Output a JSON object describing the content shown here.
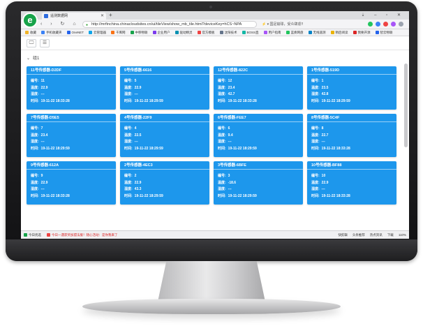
{
  "browser": {
    "tab_title": "遥测数据网",
    "new_tab": "+",
    "window_controls": "⇣ – ▫ ✕",
    "nav_buttons": "‹ › ↻ ⌂",
    "url": "http://mrfinchina.chinacloudsites.cn/ui/tileView/show_mb_tile.html?deviceKey=hCS~NPA",
    "address_extra": "⚡ ▾  国足输球，受众肆虐!!"
  },
  "bookmarks": [
    {
      "label": "收藏",
      "color": "#f0b429"
    },
    {
      "label": "手机收藏夹",
      "color": "#3b82f6"
    },
    {
      "label": "OneNET",
      "color": "#2563eb"
    },
    {
      "label": "云管理器",
      "color": "#0ea5e9"
    },
    {
      "label": "千库网",
      "color": "#f97316"
    },
    {
      "label": "中移物联",
      "color": "#16a34a"
    },
    {
      "label": "企业用户",
      "color": "#7c3aed"
    },
    {
      "label": "驱动精灵",
      "color": "#0891b2"
    },
    {
      "label": "官方模板",
      "color": "#ef4444"
    },
    {
      "label": "沈阳技术",
      "color": "#64748b"
    },
    {
      "label": "BOSS直",
      "color": "#14b8a6"
    },
    {
      "label": "用户指南",
      "color": "#a855f7"
    },
    {
      "label": "蓝奏网盘",
      "color": "#22c55e"
    },
    {
      "label": "无线遥测",
      "color": "#0284c7"
    },
    {
      "label": "稍后阅读",
      "color": "#eab308"
    },
    {
      "label": "我要开源",
      "color": "#dc2626"
    },
    {
      "label": "智云物联",
      "color": "#2563eb"
    }
  ],
  "toolbar": {
    "monitor_icon_label": "🖵",
    "list_icon_label": "☰"
  },
  "group": {
    "toggle": "⌄",
    "title": "组1"
  },
  "field_labels": {
    "id": "编号:",
    "temp": "温度:",
    "humidity": "湿度:",
    "time": "时间:"
  },
  "sensors": [
    {
      "name": "11号传感器-D2DF",
      "id": "11",
      "temp": "22.9",
      "humidity": "---",
      "time": "19-11-22 18:33:28"
    },
    {
      "name": "5号传感器-6616",
      "id": "5",
      "temp": "22.9",
      "humidity": "---",
      "time": "19-11-22 18:29:59"
    },
    {
      "name": "12号传感器-822C",
      "id": "12",
      "temp": "23.4",
      "humidity": "42.7",
      "time": "19-11-22 18:33:28"
    },
    {
      "name": "1号传感器-519D",
      "id": "1",
      "temp": "23.5",
      "humidity": "42.8",
      "time": "19-11-22 18:29:59"
    },
    {
      "name": "7号传感器-D5E5",
      "id": "7",
      "temp": "23.4",
      "humidity": "---",
      "time": "19-11-22 18:29:59"
    },
    {
      "name": "4号传感器-22F9",
      "id": "4",
      "temp": "22.5",
      "humidity": "---",
      "time": "19-11-22 18:29:59"
    },
    {
      "name": "6号传感器-FEE7",
      "id": "6",
      "temp": "9.4",
      "humidity": "---",
      "time": "19-11-22 18:29:59"
    },
    {
      "name": "8号传感器-5C4F",
      "id": "8",
      "temp": "22.7",
      "humidity": "---",
      "time": "19-11-22 18:33:28"
    },
    {
      "name": "9号传感器-612A",
      "id": "9",
      "temp": "22.9",
      "humidity": "---",
      "time": "19-11-22 18:33:28"
    },
    {
      "name": "2号传感器-4EC3",
      "id": "2",
      "temp": "22.9",
      "humidity": "43.3",
      "time": "19-11-22 18:29:59"
    },
    {
      "name": "3号传感器-6BFE",
      "id": "3",
      "temp": "-18.6",
      "humidity": "---",
      "time": "19-11-22 18:29:59"
    },
    {
      "name": "10号传感器-BF88",
      "id": "10",
      "temp": "22.9",
      "humidity": "---",
      "time": "19-11-22 18:33:28"
    }
  ],
  "taskbar": {
    "start": "今日优选",
    "news": "今日一遇获奖加盟法服！随心活动：是你我来了",
    "right_items": [
      "快剪辑",
      "头条推荐",
      "热点资讯",
      "下载",
      "110%"
    ]
  },
  "colors": {
    "card_bg": "#1d97ec",
    "logo": "#17a34a"
  }
}
